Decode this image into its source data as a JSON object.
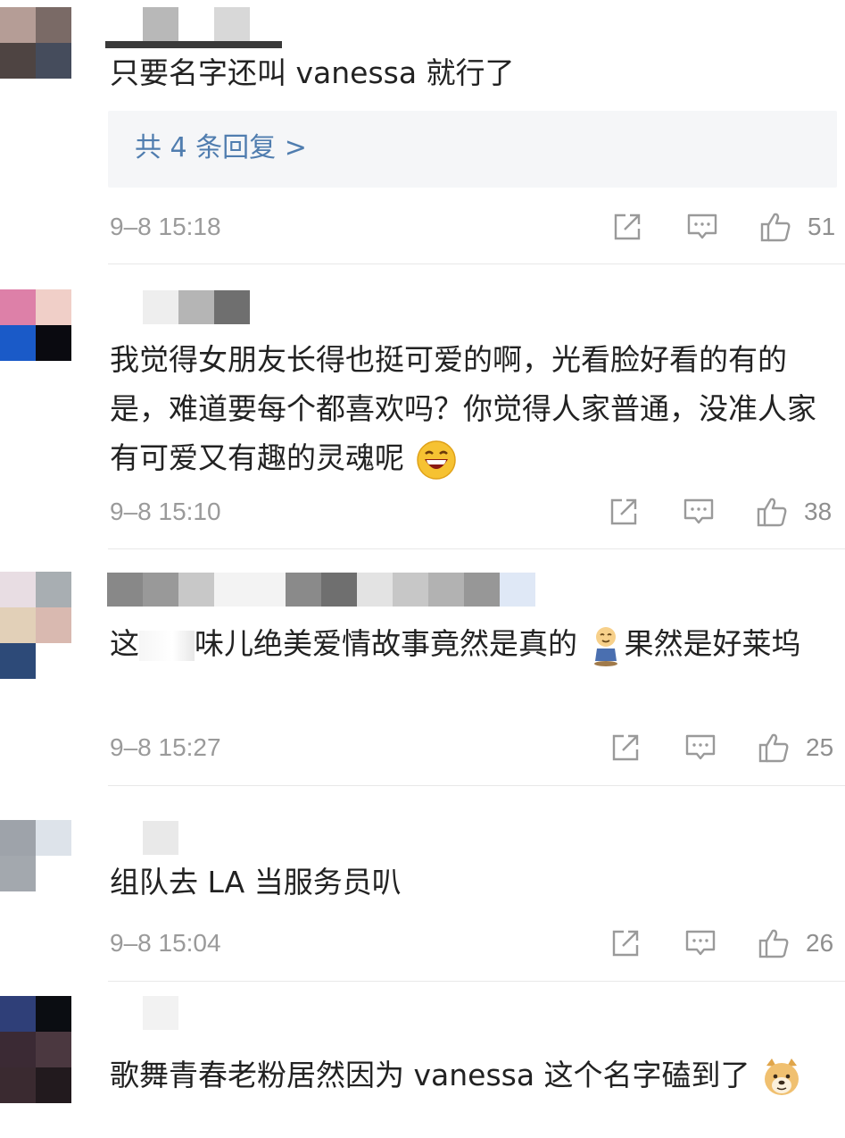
{
  "colors": {
    "text": "#222222",
    "link": "#507daf",
    "meta": "#9a9a9a",
    "reply_bg": "#f5f6f8",
    "divider": "#e8e8e8"
  },
  "icons": {
    "share": "share-icon",
    "comment": "comment-icon",
    "like": "thumbs-up-icon"
  },
  "comments": [
    {
      "text": "只要名字还叫 vanessa 就行了",
      "replies_label": "共 4 条回复 >",
      "time": "9–8 15:18",
      "likes": "51"
    },
    {
      "text": "我觉得女朋友长得也挺可爱的啊，光看脸好看的有的是，难道要每个都喜欢吗？你觉得人家普通，没准人家有可爱又有趣的灵魂呢",
      "emoji": "laughing-face-emoji",
      "time": "9–8 15:10",
      "likes": "38"
    },
    {
      "text_before": "这",
      "text_middle": "味儿绝美爱情故事竟然是真的",
      "emoji": "drooling-figure-emoji",
      "text_after": "果然是好莱坞",
      "time": "9–8 15:27",
      "likes": "25"
    },
    {
      "text": "组队去 LA 当服务员叭",
      "time": "9–8 15:04",
      "likes": "26"
    },
    {
      "text": "歌舞青春老粉居然因为 vanessa 这个名字磕到了",
      "emoji": "doge-emoji"
    }
  ]
}
